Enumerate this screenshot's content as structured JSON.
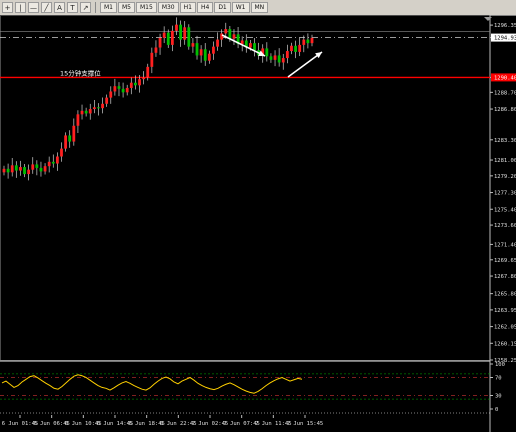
{
  "toolbar": {
    "tool_icons": [
      "crosshair-icon",
      "vertical-line-icon",
      "horizontal-line-icon",
      "trendline-icon",
      "text-icon",
      "text-label-icon",
      "arrow-icon"
    ],
    "text_tool_label": "A",
    "label_tool_label": "T",
    "timeframes": [
      "M1",
      "M5",
      "M15",
      "M30",
      "H1",
      "H4",
      "D1",
      "W1",
      "MN"
    ]
  },
  "chart": {
    "annotation_text": "15分钟支撑位",
    "current_price": "1294.93",
    "support_price": "1290.40",
    "colors": {
      "bull": "#ff2020",
      "bear": "#00c000",
      "wick": "#d0d0d0",
      "support": "#ff0000",
      "bid": "#d0d0d0",
      "rsi": "#ffd000",
      "levels": "#ff4040",
      "arrow": "#ffffff",
      "background": "#000000"
    }
  },
  "price_axis": [
    "1296.35",
    "1294.93",
    "1290.40",
    "1288.70",
    "1286.80",
    "1283.30",
    "1281.00",
    "1279.20",
    "1277.30",
    "1275.40",
    "1273.60",
    "1271.40",
    "1269.65",
    "1267.80",
    "1265.80",
    "1263.95",
    "1262.05",
    "1260.15",
    "1258.25"
  ],
  "rsi_axis": [
    "100",
    "70",
    "30",
    "0"
  ],
  "time_axis": [
    "6 Jun 01:45",
    "6 Jun 06:45",
    "6 Jun 10:45",
    "6 Jun 14:45",
    "6 Jun 18:45",
    "6 Jun 22:45",
    "7 Jun 02:45",
    "7 Jun 07:45",
    "7 Jun 11:45",
    "7 Jun 15:45"
  ],
  "chart_data": {
    "type": "candlestick",
    "ylim": [
      1258.25,
      1297.5
    ],
    "closes": [
      1280.0,
      1279.6,
      1280.4,
      1279.8,
      1280.2,
      1279.4,
      1279.9,
      1280.5,
      1280.1,
      1279.7,
      1280.3,
      1280.8,
      1280.6,
      1281.4,
      1282.3,
      1283.8,
      1283.1,
      1284.9,
      1286.2,
      1286.6,
      1286.3,
      1286.8,
      1287.0,
      1286.9,
      1287.4,
      1288.1,
      1288.8,
      1289.4,
      1289.1,
      1288.7,
      1289.2,
      1289.8,
      1289.5,
      1290.2,
      1290.4,
      1291.6,
      1293.2,
      1293.8,
      1294.9,
      1295.5,
      1294.1,
      1295.7,
      1296.4,
      1294.7,
      1296.1,
      1293.9,
      1294.3,
      1292.9,
      1293.6,
      1292.3,
      1293.1,
      1293.9,
      1294.7,
      1295.4,
      1295.9,
      1294.8,
      1295.3,
      1294.2,
      1294.6,
      1293.8,
      1294.3,
      1293.5,
      1292.9,
      1293.7,
      1292.8,
      1292.4,
      1292.9,
      1292.1,
      1292.6,
      1293.4,
      1294.0,
      1293.3,
      1294.1,
      1294.7,
      1294.3,
      1294.9
    ],
    "rsi_values": [
      58,
      62,
      55,
      48,
      52,
      60,
      66,
      72,
      74,
      69,
      63,
      57,
      52,
      46,
      44,
      50,
      58,
      66,
      73,
      76,
      74,
      70,
      64,
      58,
      52,
      48,
      46,
      42,
      47,
      53,
      58,
      61,
      57,
      52,
      48,
      44,
      42,
      47,
      55,
      62,
      68,
      71,
      67,
      60,
      56,
      62,
      66,
      70,
      64,
      57,
      52,
      48,
      45,
      43,
      46,
      51,
      55,
      58,
      54,
      49,
      44,
      40,
      37,
      35,
      39,
      45,
      52,
      58,
      63,
      67,
      70,
      66,
      62,
      65,
      68,
      66
    ],
    "rsi_levels": [
      70,
      30
    ]
  }
}
